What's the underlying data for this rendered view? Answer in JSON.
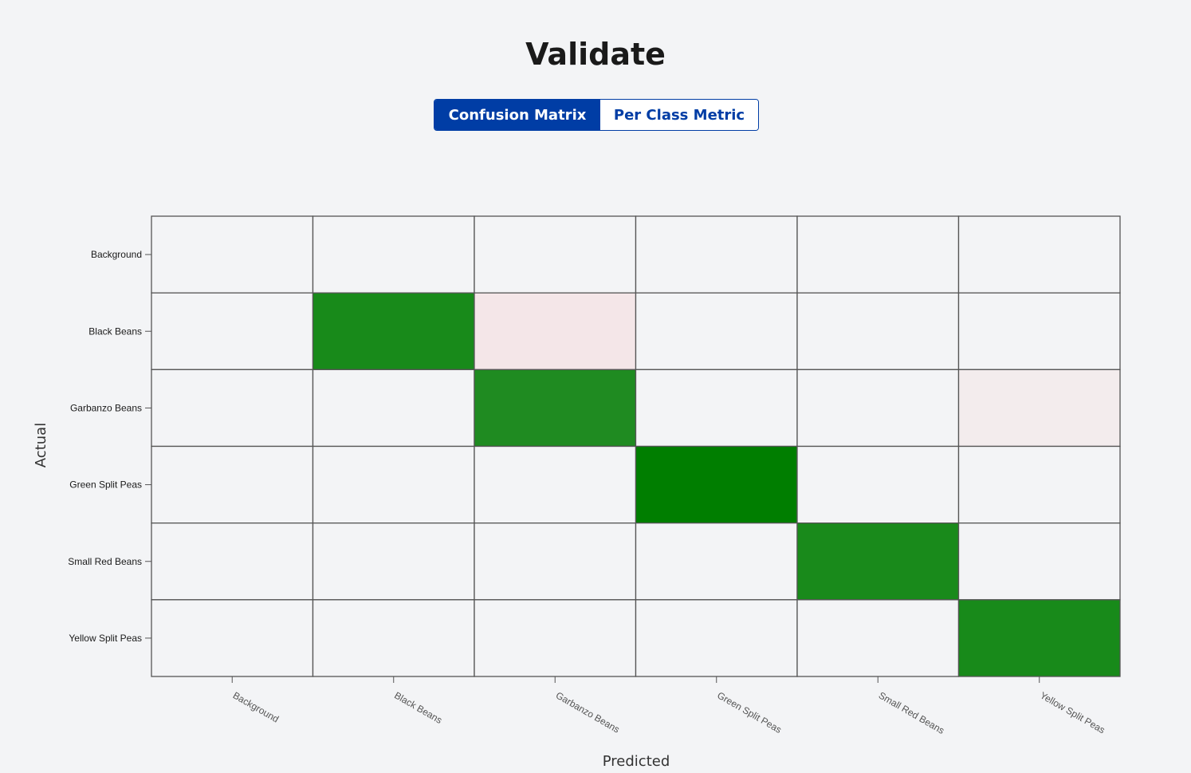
{
  "page": {
    "title": "Validate"
  },
  "tabs": {
    "confusion_matrix_label": "Confusion Matrix",
    "per_class_metric_label": "Per Class Metric",
    "active": "Confusion Matrix"
  },
  "colors": {
    "accent": "#003da5",
    "background": "#f3f4f6",
    "grid_line": "#555555",
    "high": "#008000",
    "low_error": "#f4e6e8"
  },
  "chart_data": {
    "type": "heatmap",
    "xlabel": "Predicted",
    "ylabel": "Actual",
    "x_categories": [
      "Background",
      "Black Beans",
      "Garbanzo Beans",
      "Green Split Peas",
      "Small Red Beans",
      "Yellow Split Peas"
    ],
    "y_categories": [
      "Background",
      "Black Beans",
      "Garbanzo Beans",
      "Green Split Peas",
      "Small Red Beans",
      "Yellow Split Peas"
    ],
    "values": [
      [
        0,
        0,
        0,
        0,
        0,
        0
      ],
      [
        0,
        0.9,
        0.1,
        0,
        0,
        0
      ],
      [
        0,
        0,
        0.88,
        0,
        0,
        0.05
      ],
      [
        0,
        0,
        0,
        1.0,
        0,
        0
      ],
      [
        0,
        0,
        0,
        0,
        0.9,
        0
      ],
      [
        0,
        0,
        0,
        0,
        0,
        0.9
      ]
    ],
    "colors": [
      [
        "#f3f4f6",
        "#f3f4f6",
        "#f3f4f6",
        "#f3f4f6",
        "#f3f4f6",
        "#f3f4f6"
      ],
      [
        "#f3f4f6",
        "#188a1a",
        "#f4e6e8",
        "#f3f4f6",
        "#f3f4f6",
        "#f3f4f6"
      ],
      [
        "#f3f4f6",
        "#f3f4f6",
        "#1f8b21",
        "#f3f4f6",
        "#f3f4f6",
        "#f3eced"
      ],
      [
        "#f3f4f6",
        "#f3f4f6",
        "#f3f4f6",
        "#007e00",
        "#f3f4f6",
        "#f3f4f6"
      ],
      [
        "#f3f4f6",
        "#f3f4f6",
        "#f3f4f6",
        "#f3f4f6",
        "#198a1b",
        "#f3f4f6"
      ],
      [
        "#f3f4f6",
        "#f3f4f6",
        "#f3f4f6",
        "#f3f4f6",
        "#f3f4f6",
        "#188a1a"
      ]
    ]
  }
}
